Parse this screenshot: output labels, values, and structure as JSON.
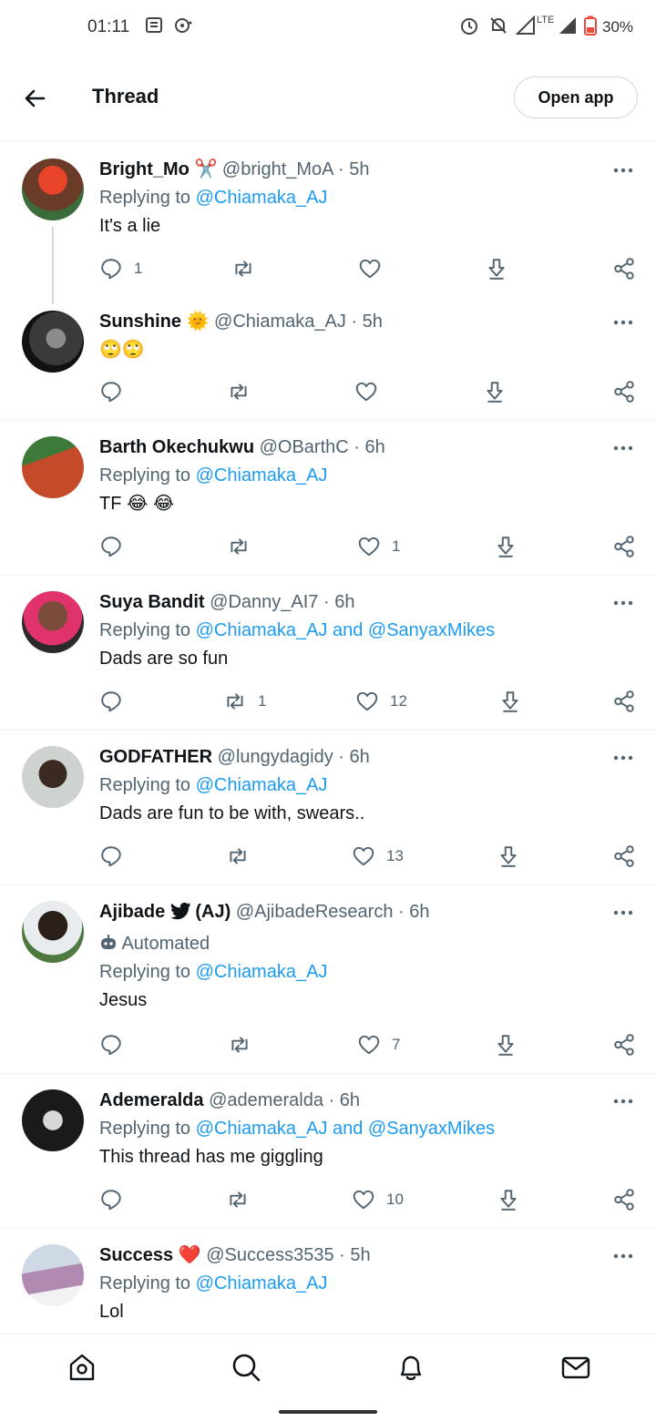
{
  "status_bar": {
    "time": "01:11",
    "battery": "30%",
    "icons": [
      "notes-icon",
      "chat-bubble-icon",
      "alarm-icon",
      "mute-icon",
      "signal-icon",
      "lte-icon",
      "signal-icon",
      "battery-icon"
    ]
  },
  "header": {
    "title": "Thread",
    "open_app_label": "Open app"
  },
  "colors": {
    "accent": "#1d9bf0",
    "text": "#0f1419",
    "secondary": "#536471",
    "like_red": "#e0245e"
  },
  "tweets": [
    {
      "name": "Bright_Mo",
      "badge_emoji": "✂️",
      "handle": "@bright_MoA",
      "sep": "·",
      "time": "5h",
      "replying_label": "Replying to",
      "replying_to": "@Chiamaka_AJ",
      "text": "It's a lie",
      "replies": "1",
      "retweets": "",
      "likes": ""
    },
    {
      "name": "Sunshine",
      "badge_emoji": "🌞",
      "handle": "@Chiamaka_AJ",
      "sep": "·",
      "time": "5h",
      "text": "🙄🙄",
      "replies": "",
      "retweets": "",
      "likes": ""
    },
    {
      "name": "Barth Okechukwu",
      "handle": "@OBarthC",
      "sep": "·",
      "time": "6h",
      "replying_label": "Replying to",
      "replying_to": "@Chiamaka_AJ",
      "text": "TF 😂 😂",
      "replies": "",
      "retweets": "",
      "likes": "1"
    },
    {
      "name": "Suya Bandit",
      "handle": "@Danny_AI7",
      "sep": "·",
      "time": "6h",
      "replying_label": "Replying to",
      "replying_to": "@Chiamaka_AJ and @SanyaxMikes",
      "text": "Dads are so fun",
      "replies": "",
      "retweets": "1",
      "likes": "12"
    },
    {
      "name": "GODFATHER",
      "handle": "@lungydagidy",
      "sep": "·",
      "time": "6h",
      "replying_label": "Replying to",
      "replying_to": "@Chiamaka_AJ",
      "text": "Dads are fun to be with, swears..",
      "replies": "",
      "retweets": "",
      "likes": "13"
    },
    {
      "name": "Ajibade",
      "name_suffix": "(AJ)",
      "handle": "@AjibadeResearch",
      "sep": "·",
      "time": "6h",
      "automated": "Automated",
      "replying_label": "Replying to",
      "replying_to": "@Chiamaka_AJ",
      "text": "Jesus",
      "replies": "",
      "retweets": "",
      "likes": "7"
    },
    {
      "name": "Ademeralda",
      "handle": "@ademeralda",
      "sep": "·",
      "time": "6h",
      "replying_label": "Replying to",
      "replying_to": "@Chiamaka_AJ and @SanyaxMikes",
      "text": "This thread has me giggling",
      "replies": "",
      "retweets": "",
      "likes": "10"
    },
    {
      "name": "Success",
      "badge_emoji": "❤️",
      "handle": "@Success3535",
      "sep": "·",
      "time": "5h",
      "replying_label": "Replying to",
      "replying_to": "@Chiamaka_AJ",
      "text": "Lol"
    }
  ],
  "bottom_nav": [
    "home-icon",
    "search-icon",
    "bell-icon",
    "mail-icon"
  ]
}
